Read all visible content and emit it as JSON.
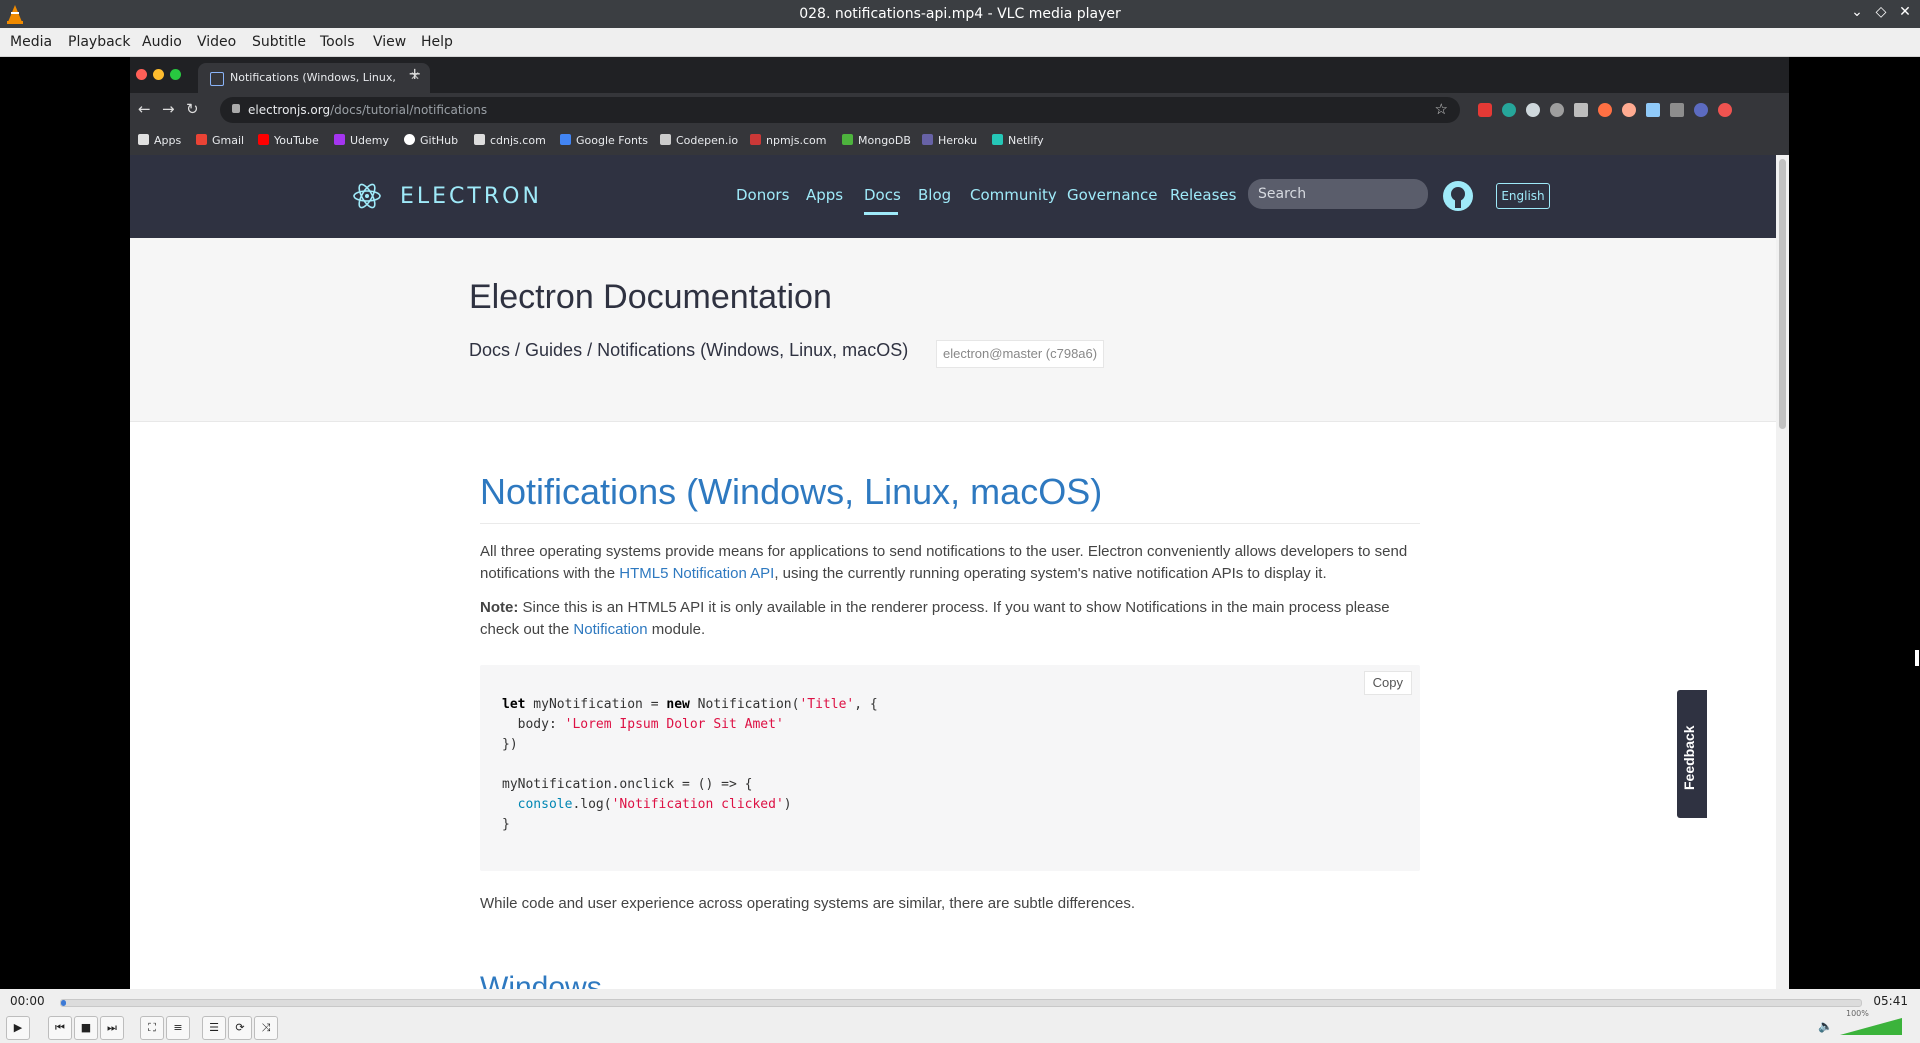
{
  "window": {
    "title": "028. notifications-api.mp4 - VLC media player",
    "min": "⌄",
    "max": "◇",
    "close": "✕"
  },
  "menu": [
    "Media",
    "Playback",
    "Audio",
    "Video",
    "Subtitle",
    "Tools",
    "View",
    "Help"
  ],
  "browser": {
    "tab_title": "Notifications (Windows, Linux,",
    "tab_close": "✕",
    "new_tab": "+",
    "url_host": "electronjs.org",
    "url_path": "/docs/tutorial/notifications",
    "bookmarks": [
      "Apps",
      "Gmail",
      "YouTube",
      "Udemy",
      "GitHub",
      "cdnjs.com",
      "Google Fonts",
      "Codepen.io",
      "npmjs.com",
      "MongoDB",
      "Heroku",
      "Netlify"
    ]
  },
  "site": {
    "brand": "ELECTRON",
    "nav": [
      "Donors",
      "Apps",
      "Docs",
      "Blog",
      "Community",
      "Governance",
      "Releases"
    ],
    "search_placeholder": "Search",
    "lang": "English",
    "hero_title": "Electron Documentation",
    "crumbs": [
      "Docs",
      "Guides",
      "Notifications (Windows, Linux, macOS)"
    ],
    "crumb_sep": " / ",
    "version": "electron@master (c798a6)",
    "h2": "Notifications (Windows, Linux, macOS)",
    "p1_a": "All three operating systems provide means for applications to send notifications to the user. Electron conveniently allows developers to send notifications with the ",
    "p1_link": "HTML5 Notification API",
    "p1_b": ", using the currently running operating system's native notification APIs to display it.",
    "note_label": "Note:",
    "p2_a": " Since this is an HTML5 API it is only available in the renderer process. If you want to show Notifications in the main process please check out the ",
    "p2_link": "Notification",
    "p2_b": " module.",
    "copy": "Copy",
    "p3": "While code and user experience across operating systems are similar, there are subtle differences.",
    "h_windows": "Windows",
    "feedback": "Feedback"
  },
  "player": {
    "time_current": "00:00",
    "time_total": "05:41",
    "progress": 0.003,
    "volume_label": "100%"
  }
}
